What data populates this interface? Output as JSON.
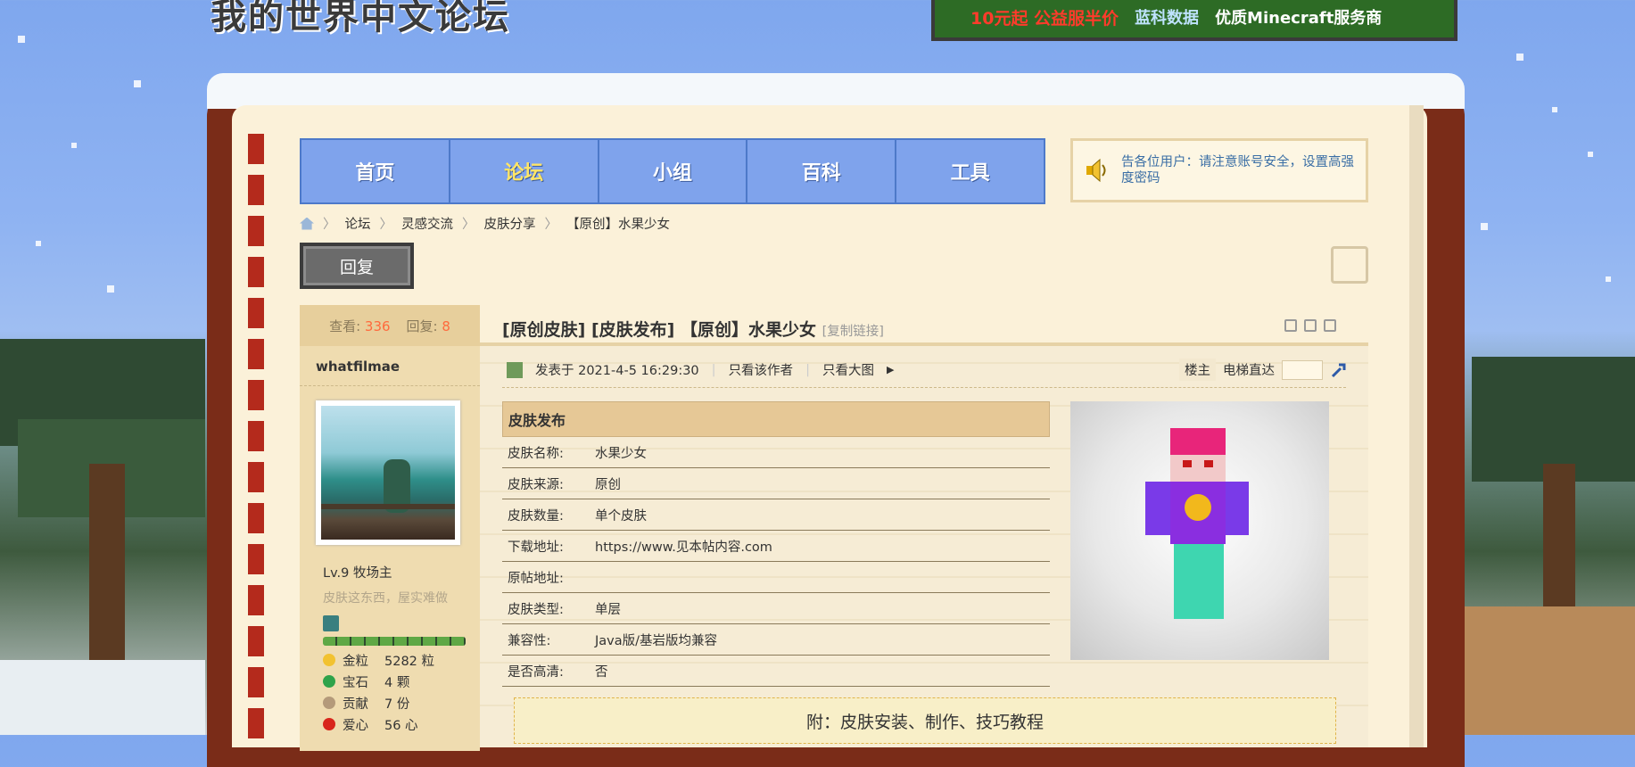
{
  "header": {
    "logo_text": "我的世界中文论坛",
    "banner": {
      "promo": "10元起 公益服半价",
      "brand": "蓝科数据",
      "tagline": "优质Minecraft服务商"
    }
  },
  "nav": {
    "items": [
      {
        "label": "首页"
      },
      {
        "label": "论坛"
      },
      {
        "label": "小组"
      },
      {
        "label": "百科"
      },
      {
        "label": "工具"
      }
    ],
    "active_index": 1
  },
  "notice": {
    "text": "告各位用户：请注意账号安全，设置高强度密码"
  },
  "breadcrumb": [
    "论坛",
    "灵感交流",
    "皮肤分享",
    "【原创】水果少女"
  ],
  "reply_button": "回复",
  "stats": {
    "views_label": "查看:",
    "views": "336",
    "replies_label": "回复:",
    "replies": "8"
  },
  "author": {
    "username": "whatfilmae",
    "level": "Lv.9 牧场主",
    "motto": "皮肤这东西，屋实难做",
    "props": [
      {
        "icon": "gold-nugget-icon",
        "name": "金粒",
        "value": "5282 粒",
        "color": "#f2c230"
      },
      {
        "icon": "emerald-icon",
        "name": "宝石",
        "value": "4 颗",
        "color": "#2fa34a"
      },
      {
        "icon": "contribution-icon",
        "name": "贡献",
        "value": "7 份",
        "color": "#b49a7a"
      },
      {
        "icon": "apple-icon",
        "name": "爱心",
        "value": "56 心",
        "color": "#d8261c"
      }
    ]
  },
  "post": {
    "title": "[原创皮肤] [皮肤发布] 【原创】水果少女",
    "copy_link": "[复制链接]",
    "posted_at": "发表于 2021-4-5 16:29:30",
    "only_author": "只看该作者",
    "only_large_image": "只看大图",
    "floor_label": "楼主",
    "elevator_label": "电梯直达"
  },
  "skin_table": {
    "heading": "皮肤发布",
    "rows": [
      {
        "key": "皮肤名称:",
        "value": "水果少女"
      },
      {
        "key": "皮肤来源:",
        "value": "原创"
      },
      {
        "key": "皮肤数量:",
        "value": "单个皮肤"
      },
      {
        "key": "下载地址:",
        "value": "https://www.见本帖内容.com"
      },
      {
        "key": "原帖地址:",
        "value": ""
      },
      {
        "key": "皮肤类型:",
        "value": "单层"
      },
      {
        "key": "兼容性:",
        "value": "Java版/基岩版均兼容"
      },
      {
        "key": "是否高清:",
        "value": "否"
      }
    ]
  },
  "tutorial": {
    "text": "附：皮肤安装、制作、技巧教程"
  },
  "colors": {
    "nav_bg": "#7fa3ec",
    "nav_active": "#ffe566",
    "accent_number": "#ff6a3d",
    "frame": "#7a2c18",
    "paper": "#fbf1d9"
  }
}
